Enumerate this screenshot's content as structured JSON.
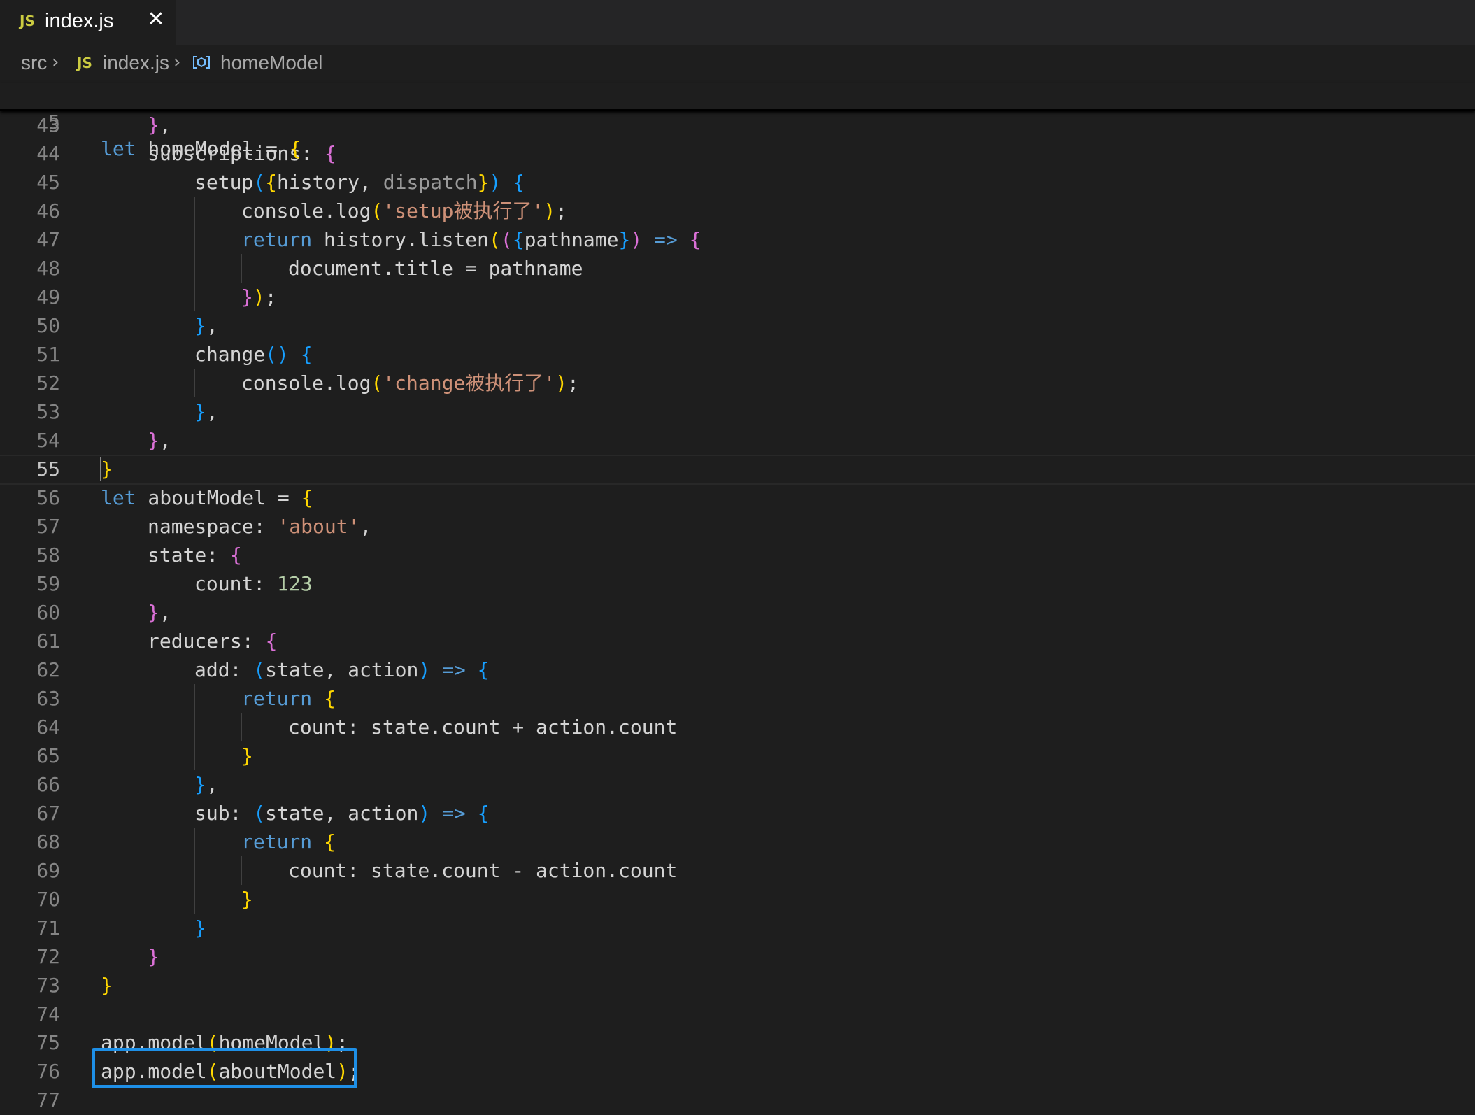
{
  "tab": {
    "icon": "JS",
    "label": "index.js",
    "close": "✕"
  },
  "breadcrumb": {
    "folder": "src",
    "file_icon": "JS",
    "file": "index.js",
    "symbol_icon": "symbol-variable-icon",
    "symbol": "homeModel"
  },
  "sticky": {
    "number": "5",
    "code": [
      {
        "t": "let",
        "c": "kw"
      },
      {
        "t": " homeModel ",
        "c": "id"
      },
      {
        "t": "=",
        "c": "id"
      },
      {
        "t": " ",
        "c": "id"
      },
      {
        "t": "{",
        "c": "b1"
      }
    ]
  },
  "lines": [
    {
      "n": "43",
      "indent": 1,
      "tokens": [
        {
          "t": "}",
          "c": "b2"
        },
        {
          "t": ",",
          "c": "id"
        }
      ]
    },
    {
      "n": "44",
      "indent": 1,
      "tokens": [
        {
          "t": "subscriptions: ",
          "c": "id"
        },
        {
          "t": "{",
          "c": "b2"
        }
      ]
    },
    {
      "n": "45",
      "indent": 2,
      "tokens": [
        {
          "t": "setup",
          "c": "id"
        },
        {
          "t": "(",
          "c": "b3"
        },
        {
          "t": "{",
          "c": "b1"
        },
        {
          "t": "history, ",
          "c": "id"
        },
        {
          "t": "dispatch",
          "c": "dim"
        },
        {
          "t": "}",
          "c": "b1"
        },
        {
          "t": ")",
          "c": "b3"
        },
        {
          "t": " ",
          "c": "id"
        },
        {
          "t": "{",
          "c": "b3"
        }
      ]
    },
    {
      "n": "46",
      "indent": 3,
      "tokens": [
        {
          "t": "console.log",
          "c": "id"
        },
        {
          "t": "(",
          "c": "b1"
        },
        {
          "t": "'setup被执行了'",
          "c": "str"
        },
        {
          "t": ")",
          "c": "b1"
        },
        {
          "t": ";",
          "c": "id"
        }
      ]
    },
    {
      "n": "47",
      "indent": 3,
      "tokens": [
        {
          "t": "return",
          "c": "kw"
        },
        {
          "t": " history.listen",
          "c": "id"
        },
        {
          "t": "(",
          "c": "b1"
        },
        {
          "t": "(",
          "c": "b2"
        },
        {
          "t": "{",
          "c": "b3"
        },
        {
          "t": "pathname",
          "c": "id"
        },
        {
          "t": "}",
          "c": "b3"
        },
        {
          "t": ")",
          "c": "b2"
        },
        {
          "t": " ",
          "c": "id"
        },
        {
          "t": "=>",
          "c": "kw"
        },
        {
          "t": " ",
          "c": "id"
        },
        {
          "t": "{",
          "c": "b2"
        }
      ]
    },
    {
      "n": "48",
      "indent": 4,
      "tokens": [
        {
          "t": "document.title = pathname",
          "c": "id"
        }
      ]
    },
    {
      "n": "49",
      "indent": 3,
      "tokens": [
        {
          "t": "}",
          "c": "b2"
        },
        {
          "t": ")",
          "c": "b1"
        },
        {
          "t": ";",
          "c": "id"
        }
      ]
    },
    {
      "n": "50",
      "indent": 2,
      "tokens": [
        {
          "t": "}",
          "c": "b3"
        },
        {
          "t": ",",
          "c": "id"
        }
      ]
    },
    {
      "n": "51",
      "indent": 2,
      "tokens": [
        {
          "t": "change",
          "c": "id"
        },
        {
          "t": "()",
          "c": "b3"
        },
        {
          "t": " ",
          "c": "id"
        },
        {
          "t": "{",
          "c": "b3"
        }
      ]
    },
    {
      "n": "52",
      "indent": 3,
      "tokens": [
        {
          "t": "console.log",
          "c": "id"
        },
        {
          "t": "(",
          "c": "b1"
        },
        {
          "t": "'change被执行了'",
          "c": "str"
        },
        {
          "t": ")",
          "c": "b1"
        },
        {
          "t": ";",
          "c": "id"
        }
      ]
    },
    {
      "n": "53",
      "indent": 2,
      "tokens": [
        {
          "t": "}",
          "c": "b3"
        },
        {
          "t": ",",
          "c": "id"
        }
      ]
    },
    {
      "n": "54",
      "indent": 1,
      "tokens": [
        {
          "t": "}",
          "c": "b2"
        },
        {
          "t": ",",
          "c": "id"
        }
      ]
    },
    {
      "n": "55",
      "indent": 0,
      "active": true,
      "tokens": [
        {
          "t": "}",
          "c": "b1 match"
        }
      ]
    },
    {
      "n": "56",
      "indent": 0,
      "tokens": [
        {
          "t": "let",
          "c": "kw"
        },
        {
          "t": " aboutModel = ",
          "c": "id"
        },
        {
          "t": "{",
          "c": "b1"
        }
      ]
    },
    {
      "n": "57",
      "indent": 1,
      "tokens": [
        {
          "t": "namespace: ",
          "c": "id"
        },
        {
          "t": "'about'",
          "c": "str"
        },
        {
          "t": ",",
          "c": "id"
        }
      ]
    },
    {
      "n": "58",
      "indent": 1,
      "tokens": [
        {
          "t": "state: ",
          "c": "id"
        },
        {
          "t": "{",
          "c": "b2"
        }
      ]
    },
    {
      "n": "59",
      "indent": 2,
      "tokens": [
        {
          "t": "count: ",
          "c": "id"
        },
        {
          "t": "123",
          "c": "num"
        }
      ]
    },
    {
      "n": "60",
      "indent": 1,
      "tokens": [
        {
          "t": "}",
          "c": "b2"
        },
        {
          "t": ",",
          "c": "id"
        }
      ]
    },
    {
      "n": "61",
      "indent": 1,
      "tokens": [
        {
          "t": "reducers: ",
          "c": "id"
        },
        {
          "t": "{",
          "c": "b2"
        }
      ]
    },
    {
      "n": "62",
      "indent": 2,
      "tokens": [
        {
          "t": "add: ",
          "c": "id"
        },
        {
          "t": "(",
          "c": "b3"
        },
        {
          "t": "state, action",
          "c": "id"
        },
        {
          "t": ")",
          "c": "b3"
        },
        {
          "t": " ",
          "c": "id"
        },
        {
          "t": "=>",
          "c": "kw"
        },
        {
          "t": " ",
          "c": "id"
        },
        {
          "t": "{",
          "c": "b3"
        }
      ]
    },
    {
      "n": "63",
      "indent": 3,
      "tokens": [
        {
          "t": "return",
          "c": "kw"
        },
        {
          "t": " ",
          "c": "id"
        },
        {
          "t": "{",
          "c": "b1"
        }
      ]
    },
    {
      "n": "64",
      "indent": 4,
      "tokens": [
        {
          "t": "count: state.count + action.count",
          "c": "id"
        }
      ]
    },
    {
      "n": "65",
      "indent": 3,
      "tokens": [
        {
          "t": "}",
          "c": "b1"
        }
      ]
    },
    {
      "n": "66",
      "indent": 2,
      "tokens": [
        {
          "t": "}",
          "c": "b3"
        },
        {
          "t": ",",
          "c": "id"
        }
      ]
    },
    {
      "n": "67",
      "indent": 2,
      "tokens": [
        {
          "t": "sub: ",
          "c": "id"
        },
        {
          "t": "(",
          "c": "b3"
        },
        {
          "t": "state, action",
          "c": "id"
        },
        {
          "t": ")",
          "c": "b3"
        },
        {
          "t": " ",
          "c": "id"
        },
        {
          "t": "=>",
          "c": "kw"
        },
        {
          "t": " ",
          "c": "id"
        },
        {
          "t": "{",
          "c": "b3"
        }
      ]
    },
    {
      "n": "68",
      "indent": 3,
      "tokens": [
        {
          "t": "return",
          "c": "kw"
        },
        {
          "t": " ",
          "c": "id"
        },
        {
          "t": "{",
          "c": "b1"
        }
      ]
    },
    {
      "n": "69",
      "indent": 4,
      "tokens": [
        {
          "t": "count: state.count - action.count",
          "c": "id"
        }
      ]
    },
    {
      "n": "70",
      "indent": 3,
      "tokens": [
        {
          "t": "}",
          "c": "b1"
        }
      ]
    },
    {
      "n": "71",
      "indent": 2,
      "tokens": [
        {
          "t": "}",
          "c": "b3"
        }
      ]
    },
    {
      "n": "72",
      "indent": 1,
      "tokens": [
        {
          "t": "}",
          "c": "b2"
        }
      ]
    },
    {
      "n": "73",
      "indent": 0,
      "tokens": [
        {
          "t": "}",
          "c": "b1"
        }
      ]
    },
    {
      "n": "74",
      "indent": 0,
      "tokens": []
    },
    {
      "n": "75",
      "indent": 0,
      "tokens": [
        {
          "t": "app.model",
          "c": "id"
        },
        {
          "t": "(",
          "c": "b1"
        },
        {
          "t": "homeModel",
          "c": "id"
        },
        {
          "t": ")",
          "c": "b1"
        },
        {
          "t": ";",
          "c": "id"
        }
      ]
    },
    {
      "n": "76",
      "indent": 0,
      "tokens": [
        {
          "t": "app.model",
          "c": "id"
        },
        {
          "t": "(",
          "c": "b1"
        },
        {
          "t": "aboutModel",
          "c": "id"
        },
        {
          "t": ")",
          "c": "b1"
        },
        {
          "t": ";",
          "c": "id"
        }
      ]
    },
    {
      "n": "77",
      "indent": 0,
      "tokens": []
    }
  ],
  "colors": {
    "highlight_box": "#1e8fe6",
    "editor_bg": "#1e1e1e"
  }
}
